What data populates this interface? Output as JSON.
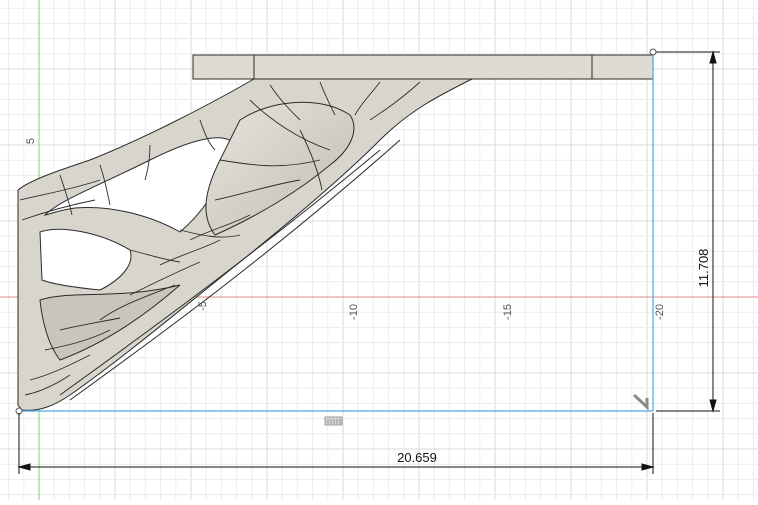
{
  "canvas": {
    "grid_minor_color": "#ececec",
    "grid_major_color": "#d9d9d9",
    "background": "#ffffff"
  },
  "axes": {
    "vertical_axis_color": "#7ad67a",
    "horizontal_axis_color": "#e08a8a"
  },
  "ruler": {
    "vertical_labels": [
      "5"
    ],
    "horizontal_labels": [
      "-5",
      "-10",
      "-15",
      "-20"
    ]
  },
  "dimensions": {
    "width_value": "20.659",
    "height_value": "11.708",
    "dimension_color": "#111111",
    "sketch_color": "#4aa8e8"
  },
  "model": {
    "surface_color": "#dcdad0",
    "shadow_color": "#b9b7ae",
    "edge_color": "#2b2b2b"
  },
  "icons": {
    "sketch_constraint": "constraint-glyph-icon",
    "corner_marker": "corner-glyph-icon"
  }
}
